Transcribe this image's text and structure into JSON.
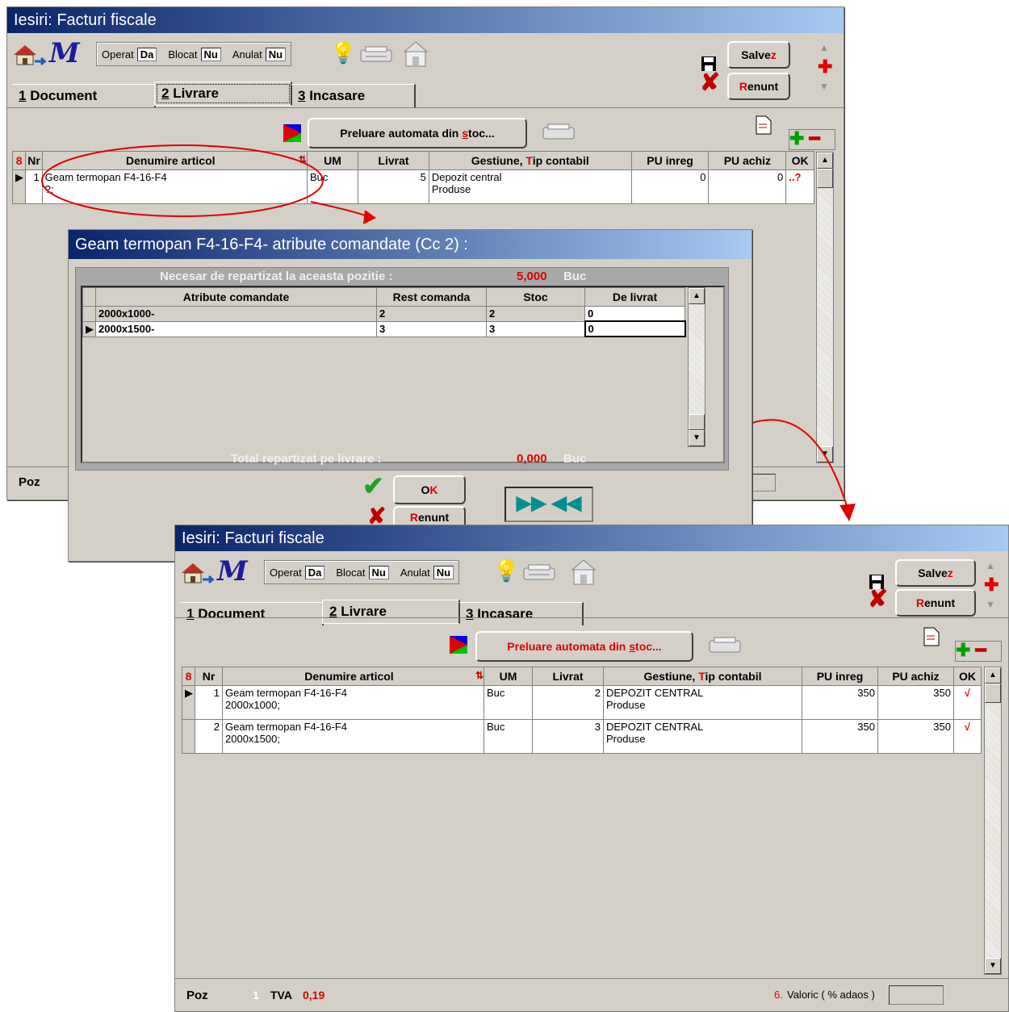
{
  "win1": {
    "title": "Iesiri: Facturi fiscale",
    "flags": [
      {
        "label": "Operat",
        "value": "Da"
      },
      {
        "label": "Blocat",
        "value": "Nu"
      },
      {
        "label": "Anulat",
        "value": "Nu"
      }
    ],
    "save_label": "Salve",
    "save_accel": "z",
    "cancel_accel": "R",
    "cancel_label": "enunt",
    "tabs": [
      {
        "num": "1",
        "label": "Document"
      },
      {
        "num": "2",
        "label": "Livrare"
      },
      {
        "num": "3",
        "label": "Incasare"
      }
    ],
    "auto_btn_pre": "Preluare automata din ",
    "auto_btn_accel": "s",
    "auto_btn_post": "toc...",
    "columns": {
      "marker": "8",
      "nr": "Nr",
      "den": "Denumire articol",
      "um": "UM",
      "livrat": "Livrat",
      "gest_pre": "Gestiune, ",
      "gest_accel": "T",
      "gest_post": "ip contabil",
      "pu_inreg": "PU inreg",
      "pu_achiz": "PU achiz",
      "ok": "OK"
    },
    "rows": [
      {
        "nr": "1",
        "den": "Geam termopan F4-16-F4",
        "den2": "?;",
        "um": "Buc",
        "livrat": "5",
        "gest": "Depozit central",
        "tip": "Produse",
        "pu_inreg": "0",
        "pu_achiz": "0",
        "ok": "..?"
      }
    ],
    "status_label": "Poz"
  },
  "dialog": {
    "title": "Geam termopan F4-16-F4- atribute comandate (Cc 2) :",
    "necesar_label": "Necesar de repartizat la aceasta pozitie :",
    "necesar_value": "5,000",
    "unit": "Buc",
    "columns": [
      "Atribute comandate",
      "Rest comanda",
      "Stoc",
      "De livrat"
    ],
    "rows": [
      {
        "attr": "2000x1000-",
        "rest": "2",
        "stoc": "2",
        "livrat": "0"
      },
      {
        "attr": "2000x1500-",
        "rest": "3",
        "stoc": "3",
        "livrat": "0"
      }
    ],
    "total_label": "Total  repartizat pe livrare :",
    "total_value": "0,000",
    "ok_label": "K",
    "ok_accel": "O",
    "cancel_accel": "R",
    "cancel_label": "enunt"
  },
  "win2": {
    "title": "Iesiri: Facturi fiscale",
    "flags": [
      {
        "label": "Operat",
        "value": "Da"
      },
      {
        "label": "Blocat",
        "value": "Nu"
      },
      {
        "label": "Anulat",
        "value": "Nu"
      }
    ],
    "save_label": "Salve",
    "save_accel": "z",
    "cancel_accel": "R",
    "cancel_label": "enunt",
    "tabs": [
      {
        "num": "1",
        "label": "Document"
      },
      {
        "num": "2",
        "label": "Livrare"
      },
      {
        "num": "3",
        "label": "Incasare"
      }
    ],
    "auto_btn_pre": "Preluare automata din ",
    "auto_btn_accel": "s",
    "auto_btn_post": "toc...",
    "columns": {
      "marker": "8",
      "nr": "Nr",
      "den": "Denumire articol",
      "um": "UM",
      "livrat": "Livrat",
      "gest_pre": "Gestiune, ",
      "gest_accel": "T",
      "gest_post": "ip contabil",
      "pu_inreg": "PU inreg",
      "pu_achiz": "PU achiz",
      "ok": "OK"
    },
    "rows": [
      {
        "nr": "1",
        "den": "Geam termopan F4-16-F4",
        "den2": "2000x1000;",
        "um": "Buc",
        "livrat": "2",
        "gest": "DEPOZIT CENTRAL",
        "tip": "Produse",
        "pu_inreg": "350",
        "pu_achiz": "350",
        "ok": "√"
      },
      {
        "nr": "2",
        "den": "Geam termopan F4-16-F4",
        "den2": "2000x1500;",
        "um": "Buc",
        "livrat": "3",
        "gest": "DEPOZIT CENTRAL",
        "tip": "Produse",
        "pu_inreg": "350",
        "pu_achiz": "350",
        "ok": "√"
      }
    ],
    "status_label": "Poz",
    "status_pos": "1",
    "tva_label": "TVA",
    "tva_value": "0,19",
    "valoric_num": "6.",
    "valoric_label": "Valoric ( % adaos )"
  },
  "colors": {
    "title_start": "#0a246a",
    "title_end": "#a6caf0",
    "accent_red": "#e00000",
    "face": "#d4d0c8"
  }
}
